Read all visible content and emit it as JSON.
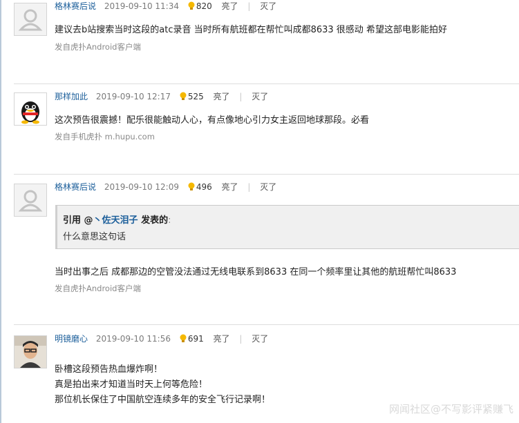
{
  "posts": [
    {
      "user": "格林赛后说",
      "time": "2019-09-10 11:34",
      "light_count": "820",
      "like": "亮了",
      "divider": "|",
      "dislike": "灭了",
      "lines": [
        "建议去b站搜索当时这段的atc录音 当时所有航班都在帮忙叫成都8633 很感动 希望这部电影能拍好"
      ],
      "source": "发自虎扑Android客户端"
    },
    {
      "user": "那样加此",
      "time": "2019-09-10 12:17",
      "light_count": "525",
      "like": "亮了",
      "divider": "|",
      "dislike": "灭了",
      "lines": [
        "这次预告很震撼！配乐很能触动人心，有点像地心引力女主返回地球那段。必看"
      ],
      "source": "发自手机虎扑 m.hupu.com"
    },
    {
      "user": "格林赛后说",
      "time": "2019-09-10 12:09",
      "light_count": "496",
      "like": "亮了",
      "divider": "|",
      "dislike": "灭了",
      "quote": {
        "prefix": "引用 @",
        "name": "丶佐天泪子",
        "suffix": " 发表的",
        "colon": ":",
        "text": "什么意思这句话"
      },
      "lines": [
        "当时出事之后 成都那边的空管没法通过无线电联系到8633 在同一个频率里让其他的航班帮忙叫8633"
      ],
      "source": "发自虎扑Android客户端"
    },
    {
      "user": "明镜磨心",
      "time": "2019-09-10 11:56",
      "light_count": "691",
      "like": "亮了",
      "divider": "|",
      "dislike": "灭了",
      "lines": [
        "卧槽这段预告热血爆炸啊！",
        "真是拍出来才知道当时天上何等危险！",
        "那位机长保住了中国航空连续多年的安全飞行记录啊！"
      ]
    }
  ],
  "watermark": "网闻社区@不写影评紧赚飞",
  "colors": {
    "username": "#1b5e9a",
    "separator": "#dddddd",
    "quote_bg": "#f0f0f0",
    "bulb": "#f5b800"
  }
}
